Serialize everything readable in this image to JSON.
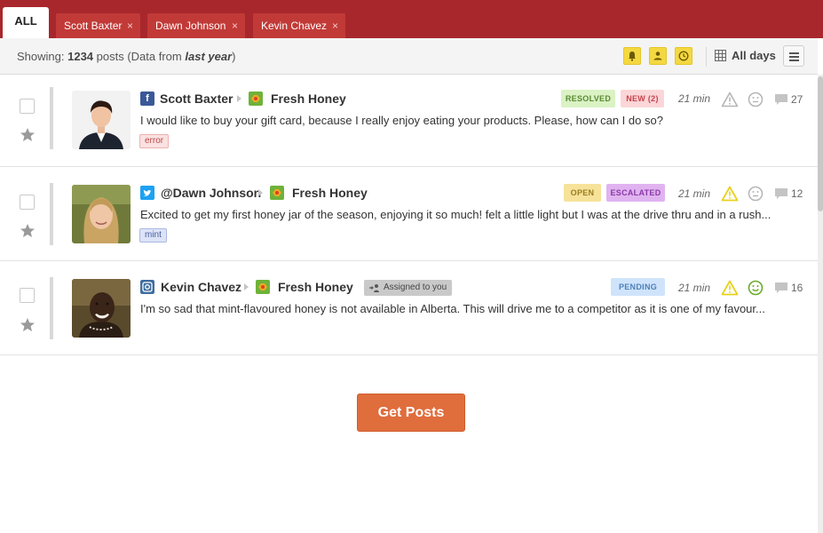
{
  "tabs": {
    "all_label": "ALL",
    "people": [
      {
        "label": "Scott Baxter",
        "close": "×"
      },
      {
        "label": "Dawn Johnson",
        "close": "×"
      },
      {
        "label": "Kevin Chavez",
        "close": "×"
      }
    ]
  },
  "status": {
    "showing_label": "Showing:",
    "count": "1234",
    "posts_text": "posts (Data from",
    "period": "last year",
    "close_paren": ")",
    "date_range": "All days"
  },
  "posts": [
    {
      "author": "Scott Baxter",
      "network": "facebook",
      "network_glyph": "f",
      "brand": "Fresh Honey",
      "badges": [
        "RESOLVED",
        "NEW (2)"
      ],
      "time": "21 min",
      "comments": "27",
      "message": "I would like to buy your gift card, because I really enjoy eating your products. Please, how can I do so?",
      "tag": "error"
    },
    {
      "author": "@Dawn Johnson",
      "network": "twitter",
      "brand": "Fresh Honey",
      "badges": [
        "OPEN",
        "ESCALATED"
      ],
      "time": "21 min",
      "comments": "12",
      "message": "Excited to get my first honey jar of the season, enjoying it so much! felt a little light but I was at the drive thru and in a rush...",
      "tag": "mint"
    },
    {
      "author": "Kevin Chavez",
      "network": "instagram",
      "brand": "Fresh Honey",
      "assigned": "Assigned to you",
      "badges": [
        "PENDING"
      ],
      "time": "21 min",
      "comments": "16",
      "message": "I'm so sad that mint-flavoured honey is not available in Alberta. This will drive me to a competitor as it is one of my favour..."
    }
  ],
  "actions": {
    "get_posts": "Get Posts"
  },
  "colors": {
    "tabbar": "#a8272c",
    "tab_person": "#c13a37",
    "get_posts": "#e06d3c",
    "resolved_bg": "#daf2c4",
    "new_bg": "#fbd6d8",
    "open_bg": "#f7e29a",
    "escalated_bg": "#e0b3f0",
    "pending_bg": "#cfe4fb",
    "warning": "#e6d21e",
    "positive": "#6bab2b"
  }
}
